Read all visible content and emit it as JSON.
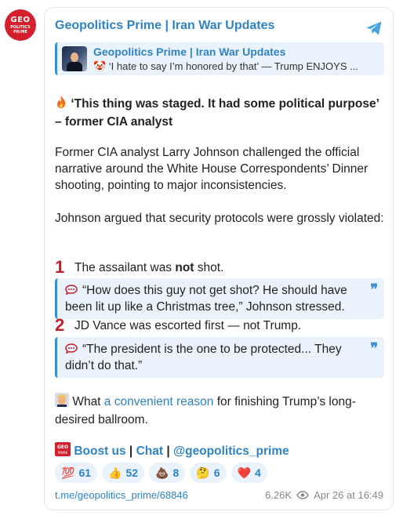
{
  "channel": {
    "name": "Geopolitics Prime | Iran War Updates",
    "avatar": {
      "line1": "GEO",
      "line2": "POLITICS",
      "line3": "PRIME"
    }
  },
  "reply": {
    "name": "Geopolitics Prime | Iran War Updates",
    "text": "🤡 ‘I hate to say I’m honored by that’ — Trump ENJOYS ..."
  },
  "post": {
    "headline": "‘This thing was staged. It had some political purpose’ – former CIA analyst",
    "para1": "Former CIA analyst Larry Johnson challenged the official narrative around the White House Correspondents’ Dinner shooting, pointing to major inconsistencies.",
    "para2": "Johnson argued that security protocols were grossly violated:",
    "point1": {
      "num": "1",
      "pre": "The assailant was ",
      "bold": "not",
      "post": " shot."
    },
    "quote1": "“How does this guy not get shot? He should have been lit up like a Christmas tree,” Johnson stressed.",
    "point2": {
      "num": "2",
      "text": "JD Vance was escorted first — not Trump."
    },
    "quote2": "“The president is the one to be protected... They didn’t do that.”",
    "closing": {
      "pre": "What ",
      "link": "a convenient reason",
      "post": " for finishing Trump’s long-desired ballroom."
    }
  },
  "links": {
    "boost": "Boost us",
    "sep1": " | ",
    "chat": "Chat",
    "sep2": " | ",
    "handle": "@geopolitics_prime"
  },
  "reactions": [
    {
      "emoji": "💯",
      "count": "61"
    },
    {
      "emoji": "👍",
      "count": "52"
    },
    {
      "emoji": "💩",
      "count": "8"
    },
    {
      "emoji": "🤔",
      "count": "6"
    },
    {
      "emoji": "❤️",
      "count": "4"
    }
  ],
  "footer": {
    "link": "t.me/geopolitics_prime/68846",
    "views": "6.26K",
    "time": "Apr 26 at 16:49"
  },
  "colors": {
    "accent": "#2f83c4",
    "brand_red": "#d4202c",
    "quote_bg": "#eaf3fb"
  },
  "icons": {
    "share": "telegram-share-icon",
    "views": "eye-icon",
    "quote": "speech-bubble-icon"
  }
}
